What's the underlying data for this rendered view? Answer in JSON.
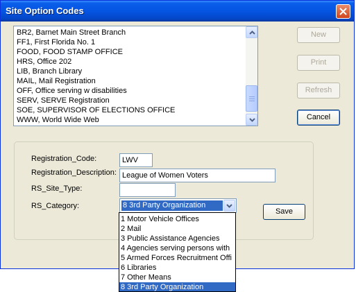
{
  "window": {
    "title": "Site Option Codes"
  },
  "site_list": {
    "items": [
      "BR2, Barnet Main Street Branch",
      "FF1, First Florida No. 1",
      "FOOD, FOOD STAMP OFFICE",
      "HRS, Office 202",
      "LIB, Branch Library",
      "MAIL, Mail Registration",
      "OFF, Office serving w disabilities",
      "SERV, SERVE Registration",
      "SOE, SUPERVISOR OF ELECTIONS OFFICE",
      "WWW, World Wide Web"
    ]
  },
  "buttons": {
    "new": "New",
    "print": "Print",
    "refresh": "Refresh",
    "cancel": "Cancel",
    "save": "Save"
  },
  "form": {
    "registration_code": {
      "label": "Registration_Code:",
      "value": "LWV"
    },
    "registration_description": {
      "label": "Registration_Description:",
      "value": "League of Women Voters"
    },
    "rs_site_type": {
      "label": "RS_Site_Type:",
      "value": ""
    },
    "rs_category": {
      "label": "RS_Category:",
      "value": "8   3rd Party Organization"
    }
  },
  "category_options": [
    "1   Motor Vehicle Offices",
    "2   Mail",
    "3   Public Assistance Agencies",
    "4   Agencies serving persons with",
    "5   Armed Forces Recruitment Offi",
    "6   Libraries",
    "7   Other Means",
    "8   3rd Party Organization"
  ],
  "category_selected_index": 7,
  "colors": {
    "title_bar": "#0555e3",
    "selection": "#316ac5",
    "dialog_bg": "#ece9d8"
  }
}
